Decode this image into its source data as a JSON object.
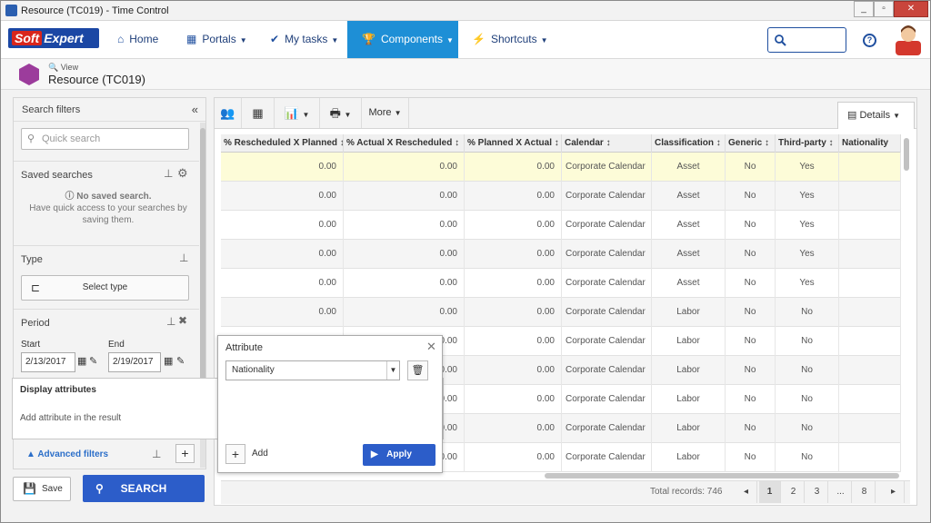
{
  "window": {
    "title": "Resource (TC019) - Time Control"
  },
  "nav": {
    "logo": "SoftExpert",
    "home": "Home",
    "portals": "Portals",
    "my_tasks": "My tasks",
    "components": "Components",
    "shortcuts": "Shortcuts"
  },
  "page": {
    "mode": "View",
    "title": "Resource (TC019)"
  },
  "filters": {
    "title": "Search filters",
    "quick_search_placeholder": "Quick search",
    "saved_searches_title": "Saved searches",
    "no_saved_title": "No saved search.",
    "no_saved_desc": "Have quick access to your searches by saving them.",
    "type_title": "Type",
    "select_type": "Select type",
    "period_title": "Period",
    "start_label": "Start",
    "end_label": "End",
    "start_value": "2/13/2017",
    "end_value": "2/19/2017",
    "advanced_filters": "Advanced filters",
    "save": "Save",
    "search": "SEARCH"
  },
  "display_attributes": {
    "title": "Display attributes",
    "desc": "Add attribute in the result"
  },
  "attribute_popup": {
    "title": "Attribute",
    "selected": "Nationality",
    "add": "Add",
    "apply": "Apply"
  },
  "toolbar": {
    "more": "More",
    "details": "Details"
  },
  "grid": {
    "columns": [
      "% Rescheduled X Planned",
      "% Actual X Rescheduled",
      "% Planned X Actual",
      "Calendar",
      "Classification",
      "Generic",
      "Third-party",
      "Nationality"
    ],
    "rows": [
      [
        "0.00",
        "0.00",
        "0.00",
        "Corporate Calendar",
        "Asset",
        "No",
        "Yes",
        ""
      ],
      [
        "0.00",
        "0.00",
        "0.00",
        "Corporate Calendar",
        "Asset",
        "No",
        "Yes",
        ""
      ],
      [
        "0.00",
        "0.00",
        "0.00",
        "Corporate Calendar",
        "Asset",
        "No",
        "Yes",
        ""
      ],
      [
        "0.00",
        "0.00",
        "0.00",
        "Corporate Calendar",
        "Asset",
        "No",
        "Yes",
        ""
      ],
      [
        "0.00",
        "0.00",
        "0.00",
        "Corporate Calendar",
        "Asset",
        "No",
        "Yes",
        ""
      ],
      [
        "0.00",
        "0.00",
        "0.00",
        "Corporate Calendar",
        "Labor",
        "No",
        "No",
        ""
      ],
      [
        "",
        "0.00",
        "0.00",
        "Corporate Calendar",
        "Labor",
        "No",
        "No",
        ""
      ],
      [
        "",
        "0.00",
        "0.00",
        "Corporate Calendar",
        "Labor",
        "No",
        "No",
        ""
      ],
      [
        "",
        "0.00",
        "0.00",
        "Corporate Calendar",
        "Labor",
        "No",
        "No",
        ""
      ],
      [
        "",
        "0.00",
        "0.00",
        "Corporate Calendar",
        "Labor",
        "No",
        "No",
        ""
      ],
      [
        "",
        "0.00",
        "0.00",
        "Corporate Calendar",
        "Labor",
        "No",
        "No",
        ""
      ]
    ],
    "total_label": "Total records: 746",
    "pages": [
      "1",
      "2",
      "3",
      "...",
      "8"
    ],
    "current_page": "1"
  },
  "colors": {
    "accent": "#1e8fd6",
    "primary_button": "#2c5dc9",
    "highlight_row": "#fdfcd8",
    "alt_row": "#f5f5f5"
  }
}
